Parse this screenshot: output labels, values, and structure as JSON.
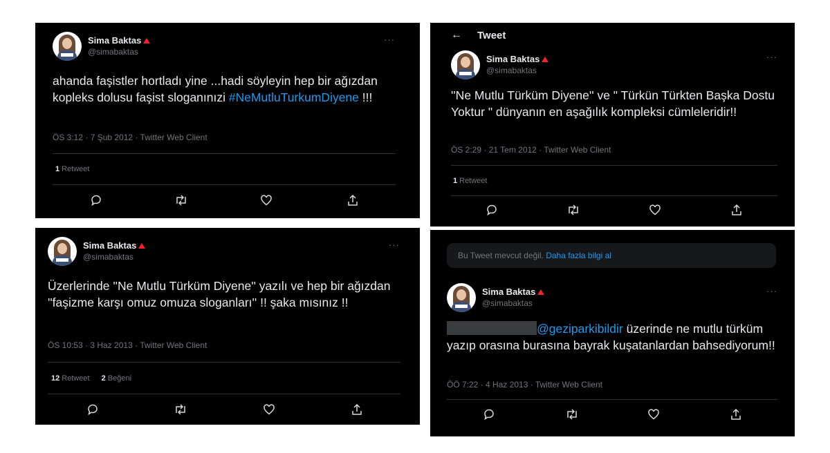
{
  "tweets": [
    {
      "name": "Sima Baktas",
      "handle": "@simabaktas",
      "text_pre": "ahanda faşistler hortladı yine ...hadi söyleyin hep bir ağızdan kopleks dolusu faşist sloganınızi ",
      "hashtag": "#NeMutluTurkumDiyene",
      "text_post": " !!!",
      "meta": "ÖS 3:12 · 7 Şub 2012 · Twitter Web Client",
      "retweets_count": "1",
      "retweets_label": "Retweet"
    },
    {
      "title": "Tweet",
      "back_icon": "←",
      "name": "Sima Baktas",
      "handle": "@simabaktas",
      "text": "''Ne Mutlu Türküm Diyene''  ve \" Türkün Türkten Başka Dostu Yoktur \" dünyanın en aşağılık kompleksi cümleleridir!!",
      "meta": "ÖS 2:29 · 21 Tem 2012 · Twitter Web Client",
      "retweets_count": "1",
      "retweets_label": "Retweet"
    },
    {
      "name": "Sima Baktas",
      "handle": "@simabaktas",
      "text": "Üzerlerinde ''Ne Mutlu Türküm Diyene'' yazılı ve hep bir ağızdan ''faşizme karşı omuz omuza sloganları'' !! şaka mısınız !!",
      "meta": "ÖS 10:53 · 3 Haz 2013 · Twitter Web Client",
      "retweets_count": "12",
      "retweets_label": "Retweet",
      "likes_count": "2",
      "likes_label": "Beğeni"
    },
    {
      "banner_text": "Bu Tweet mevcut değil. ",
      "banner_link": "Daha fazla bilgi al",
      "name": "Sima Baktas",
      "handle": "@simabaktas",
      "mention": "@geziparkibildir",
      "text_post": " üzerinde ne mutlu türküm yazıp orasına burasına bayrak kuşatanlardan bahsediyorum!!",
      "meta": "ÖÖ 7:22 · 4 Haz 2013 · Twitter Web Client"
    }
  ],
  "ui": {
    "more_icon": "···"
  },
  "colors": {
    "background": "#000000",
    "link": "#1d9bf0",
    "muted": "#71767b",
    "verified_warning": "#f4212e",
    "text": "#e7e9ea",
    "page": "#ffffff"
  }
}
